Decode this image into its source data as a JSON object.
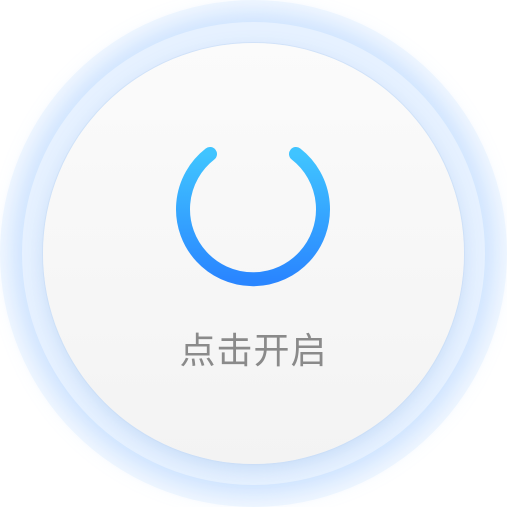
{
  "power_button": {
    "label": "点击开启",
    "icon": "power-icon"
  },
  "colors": {
    "accent_top": "#40c4ff",
    "accent_bottom": "#2a86ff",
    "label_text": "#8a8a8a",
    "button_face": "#f7f7f7",
    "halo": "#e6f1ff"
  }
}
